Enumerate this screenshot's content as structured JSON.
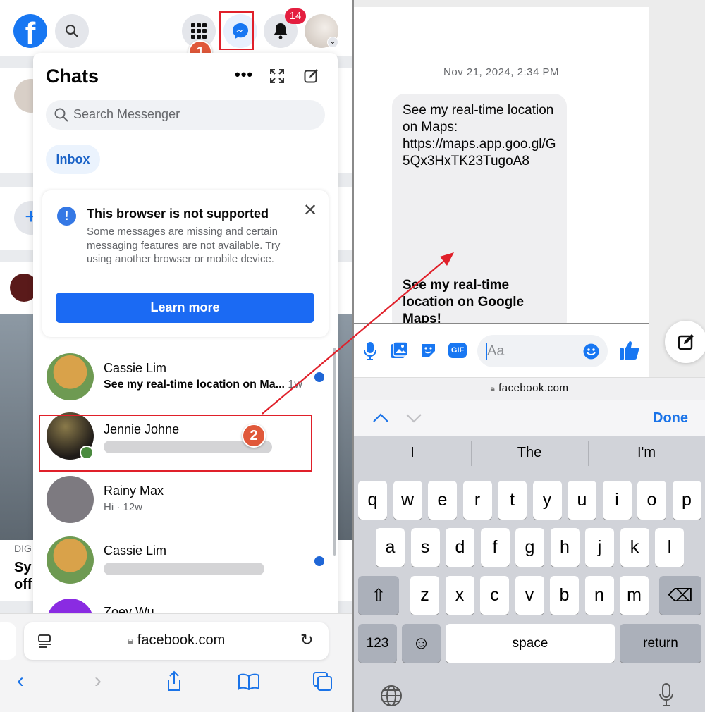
{
  "left": {
    "notifications_badge": "14",
    "step1_marker": "1",
    "step2_marker": "2",
    "chats": {
      "title": "Chats",
      "search_placeholder": "Search Messenger",
      "inbox_tab": "Inbox",
      "notice": {
        "title": "This browser is not supported",
        "body": "Some messages are missing and certain messaging features are not available. Try using another browser or mobile device.",
        "button": "Learn more"
      },
      "items": [
        {
          "name": "Cassie Lim",
          "preview": "See my real-time location on Ma...",
          "time": "1w",
          "unread": true
        },
        {
          "name": "Jennie Johne",
          "preview": "",
          "time": "",
          "online": true
        },
        {
          "name": "Rainy Max",
          "preview": "Hi · 12w"
        },
        {
          "name": "Cassie Lim",
          "preview": "",
          "unread": true
        },
        {
          "name": "Zoey Wu",
          "preview": ""
        }
      ]
    },
    "background_feed": {
      "source": "DIG",
      "headline_line1": "Sy",
      "headline_line2": "off"
    },
    "safari": {
      "url": "facebook.com"
    }
  },
  "right": {
    "timestamp": "Nov 21, 2024, 2:34 PM",
    "message": {
      "line1": "See my real-time location on Maps:",
      "link": "https://maps.app.goo.gl/G5Qx3HxTK23TugoA8",
      "line2": "See my real-time location on Google Maps!"
    },
    "composer_placeholder": "Aa",
    "url": "facebook.com",
    "done": "Done",
    "suggestions": [
      "I",
      "The",
      "I'm"
    ],
    "keyboard": {
      "row1": [
        "q",
        "w",
        "e",
        "r",
        "t",
        "y",
        "u",
        "i",
        "o",
        "p"
      ],
      "row2": [
        "a",
        "s",
        "d",
        "f",
        "g",
        "h",
        "j",
        "k",
        "l"
      ],
      "row3": [
        "z",
        "x",
        "c",
        "v",
        "b",
        "n",
        "m"
      ],
      "numbers": "123",
      "space": "space",
      "return": "return"
    }
  },
  "colors": {
    "facebook_blue": "#1877f2",
    "annotation_red": "#e0202a",
    "marker_orange": "#e0583a",
    "ios_blue": "#1a73e8"
  }
}
